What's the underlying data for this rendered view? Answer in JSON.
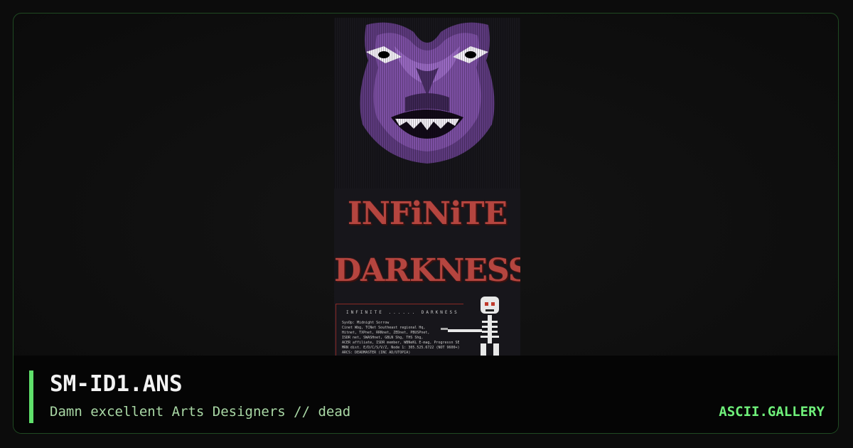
{
  "art": {
    "title_line1": "INFiNiTE",
    "title_line2": "DARKNESS",
    "info_header": "INFINITE ...... DARKNESS",
    "info_lines": [
      "SysOp: Midnight Sorrow",
      "Cinet Wbg, TCNet Southeast regional Hq,",
      "Hitnet, TXPnet, RRNnet, ZEDnet, PBUSPnet,",
      "ISDR net, SWASHnet, GBLN Shg, THS Shg,",
      "ACER affiliate, ISDR member, WBNeKL E-mag, Progressn SEHQ,",
      "MRN dist. E/D/C/S/V/Z, Node 1: 305.525.6722 (NOT 9600+)",
      "ARCS: DEADMASTER (INC AD/UTOPIA)"
    ]
  },
  "footer": {
    "title": "SM-ID1.ANS",
    "subtitle": "Damn excellent Arts Designers // dead",
    "brand": "ASCII.GALLERY"
  },
  "colors": {
    "accent": "#5fe06b",
    "brand": "#6ff07a",
    "face": "#7c4fa3",
    "title_red": "#b5453f"
  }
}
